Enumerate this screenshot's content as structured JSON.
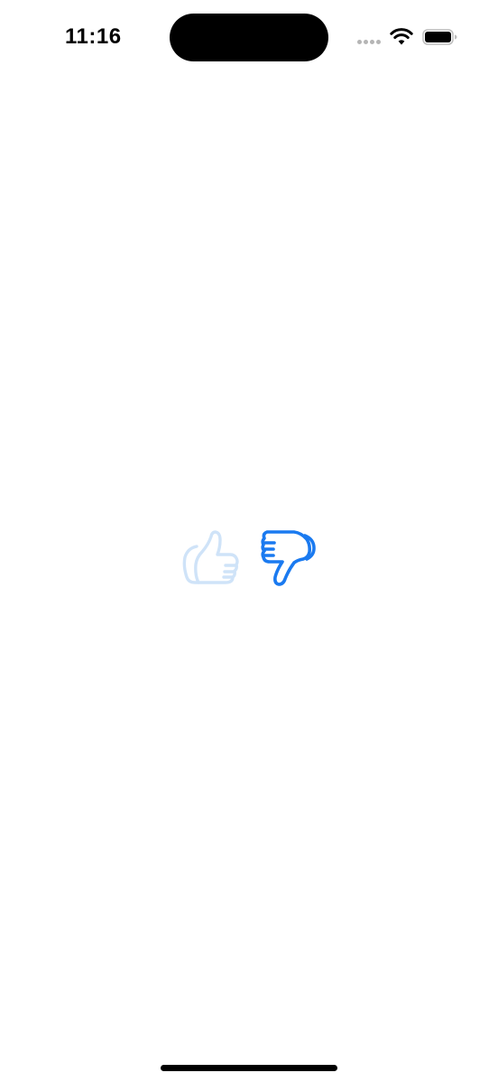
{
  "status_bar": {
    "time": "11:16",
    "icons": [
      "cellular-signal-icon",
      "wifi-icon",
      "battery-icon"
    ]
  },
  "rating": {
    "thumbs_up": {
      "icon": "thumbs-up-icon",
      "state": "unselected",
      "color": "#cfe3f8"
    },
    "thumbs_down": {
      "icon": "thumbs-down-icon",
      "state": "selected",
      "color": "#1a7af0"
    }
  }
}
